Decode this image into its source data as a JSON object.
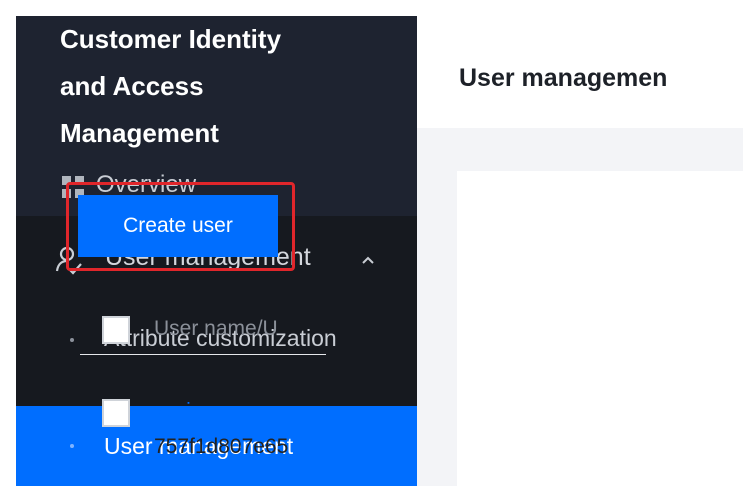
{
  "sidebar": {
    "brand_lines": [
      "Customer Identity",
      "and Access",
      "Management"
    ],
    "overview": {
      "label": "Overview",
      "icon": "grid-icon"
    },
    "user_management_group": {
      "label": "User management",
      "icon": "user-icon",
      "expanded": true
    },
    "subitems": [
      {
        "label": "Attribute customization",
        "active": false
      },
      {
        "label": "User management",
        "active": true
      }
    ]
  },
  "main": {
    "page_title": "User managemen",
    "create_button_label": "Create user",
    "table": {
      "columns": [
        "User name/U"
      ],
      "rows": [
        {
          "name": "yuni",
          "id": "757f1d807e65"
        }
      ]
    }
  },
  "colors": {
    "accent": "#006eff",
    "sidebar_bg": "#1e2330",
    "submenu_bg": "#16191f",
    "highlight": "#e0262b"
  }
}
